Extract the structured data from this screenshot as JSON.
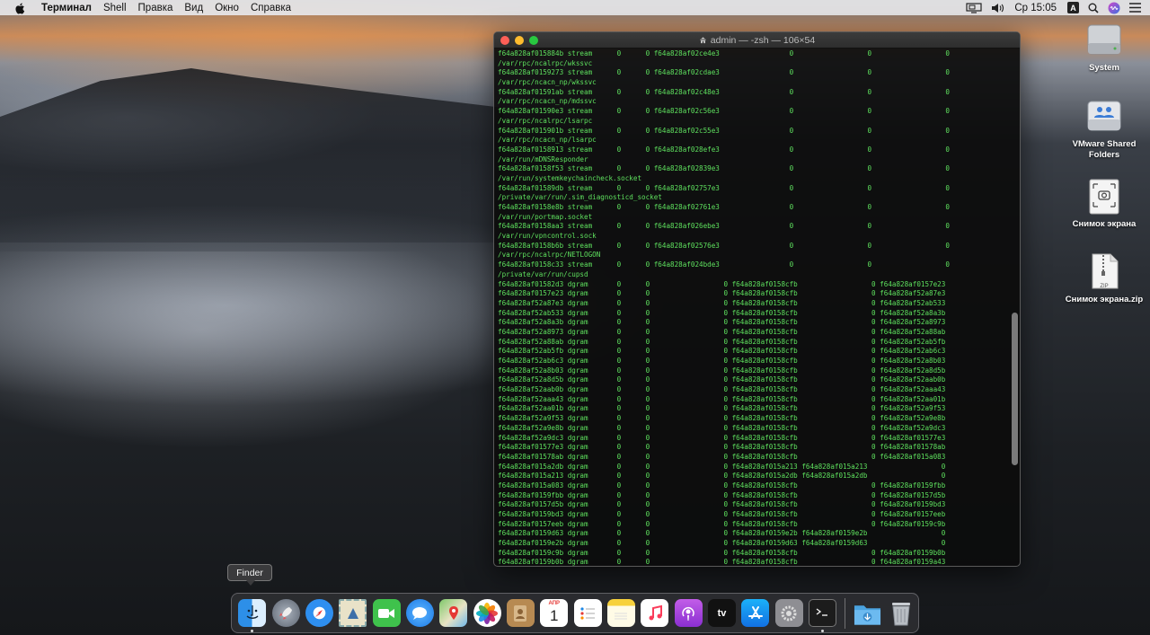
{
  "menubar": {
    "app_name": "Терминал",
    "items": [
      "Shell",
      "Правка",
      "Вид",
      "Окно",
      "Справка"
    ],
    "clock": "Ср 15:05",
    "input_source": "A"
  },
  "terminal": {
    "title": "admin — -zsh — 106×54",
    "lines": [
      "f64a828af015884b stream      0      0 f64a828af02ce4e3                 0                  0                  0",
      "/var/rpc/ncalrpc/wkssvc",
      "f64a828af0159273 stream      0      0 f64a828af02cdae3                 0                  0                  0",
      "/var/rpc/ncacn_np/wkssvc",
      "f64a828af01591ab stream      0      0 f64a828af02c48e3                 0                  0                  0",
      "/var/rpc/ncacn_np/mdssvc",
      "f64a828af01590e3 stream      0      0 f64a828af02c56e3                 0                  0                  0",
      "/var/rpc/ncalrpc/lsarpc",
      "f64a828af015901b stream      0      0 f64a828af02c55e3                 0                  0                  0",
      "/var/rpc/ncacn_np/lsarpc",
      "f64a828af0158913 stream      0      0 f64a828af028efe3                 0                  0                  0",
      "/var/run/mDNSResponder",
      "f64a828af0158f53 stream      0      0 f64a828af02839e3                 0                  0                  0",
      "/var/run/systemkeychaincheck.socket",
      "f64a828af01589db stream      0      0 f64a828af02757e3                 0                  0                  0",
      "/private/var/run/.sim_diagnosticd_socket",
      "f64a828af0158e8b stream      0      0 f64a828af02761e3                 0                  0                  0",
      "/var/run/portmap.socket",
      "f64a828af0158aa3 stream      0      0 f64a828af026ebe3                 0                  0                  0",
      "/var/run/vpncontrol.sock",
      "f64a828af0158b6b stream      0      0 f64a828af02576e3                 0                  0                  0",
      "/var/rpc/ncalrpc/NETLOGON",
      "f64a828af0158c33 stream      0      0 f64a828af024bde3                 0                  0                  0",
      "/private/var/run/cupsd",
      "f64a828af01582d3 dgram       0      0                  0 f64a828af0158cfb                  0 f64a828af0157e23",
      "f64a828af0157e23 dgram       0      0                  0 f64a828af0158cfb                  0 f64a828af52a87e3",
      "f64a828af52a87e3 dgram       0      0                  0 f64a828af0158cfb                  0 f64a828af52ab533",
      "f64a828af52ab533 dgram       0      0                  0 f64a828af0158cfb                  0 f64a828af52a8a3b",
      "f64a828af52a8a3b dgram       0      0                  0 f64a828af0158cfb                  0 f64a828af52a8973",
      "f64a828af52a8973 dgram       0      0                  0 f64a828af0158cfb                  0 f64a828af52a88ab",
      "f64a828af52a88ab dgram       0      0                  0 f64a828af0158cfb                  0 f64a828af52ab5fb",
      "f64a828af52ab5fb dgram       0      0                  0 f64a828af0158cfb                  0 f64a828af52ab6c3",
      "f64a828af52ab6c3 dgram       0      0                  0 f64a828af0158cfb                  0 f64a828af52a8b03",
      "f64a828af52a8b03 dgram       0      0                  0 f64a828af0158cfb                  0 f64a828af52a8d5b",
      "f64a828af52a8d5b dgram       0      0                  0 f64a828af0158cfb                  0 f64a828af52aab0b",
      "f64a828af52aab0b dgram       0      0                  0 f64a828af0158cfb                  0 f64a828af52aaa43",
      "f64a828af52aaa43 dgram       0      0                  0 f64a828af0158cfb                  0 f64a828af52aa01b",
      "f64a828af52aa01b dgram       0      0                  0 f64a828af0158cfb                  0 f64a828af52a9f53",
      "f64a828af52a9f53 dgram       0      0                  0 f64a828af0158cfb                  0 f64a828af52a9e8b",
      "f64a828af52a9e8b dgram       0      0                  0 f64a828af0158cfb                  0 f64a828af52a9dc3",
      "f64a828af52a9dc3 dgram       0      0                  0 f64a828af0158cfb                  0 f64a828af01577e3",
      "f64a828af01577e3 dgram       0      0                  0 f64a828af0158cfb                  0 f64a828af01578ab",
      "f64a828af01578ab dgram       0      0                  0 f64a828af0158cfb                  0 f64a828af015a083",
      "f64a828af015a2db dgram       0      0                  0 f64a828af015a213 f64a828af015a213                  0",
      "f64a828af015a213 dgram       0      0                  0 f64a828af015a2db f64a828af015a2db                  0",
      "f64a828af015a083 dgram       0      0                  0 f64a828af0158cfb                  0 f64a828af0159fbb",
      "f64a828af0159fbb dgram       0      0                  0 f64a828af0158cfb                  0 f64a828af0157d5b",
      "f64a828af0157d5b dgram       0      0                  0 f64a828af0158cfb                  0 f64a828af0159bd3",
      "f64a828af0159bd3 dgram       0      0                  0 f64a828af0158cfb                  0 f64a828af0157eeb",
      "f64a828af0157eeb dgram       0      0                  0 f64a828af0158cfb                  0 f64a828af0159c9b",
      "f64a828af0159d63 dgram       0      0                  0 f64a828af0159e2b f64a828af0159e2b                  0",
      "f64a828af0159e2b dgram       0      0                  0 f64a828af0159d63 f64a828af0159d63                  0",
      "f64a828af0159c9b dgram       0      0                  0 f64a828af0158cfb                  0 f64a828af0159b0b",
      "f64a828af0159b0b dgram       0      0                  0 f64a828af0158cfb                  0 f64a828af0159a43"
    ]
  },
  "desktop_icons": [
    {
      "label": "System",
      "icon": "hard-drive-icon"
    },
    {
      "label": "VMware Shared Folders",
      "icon": "shared-folder-icon"
    },
    {
      "label": "Снимок экрана",
      "icon": "screenshot-file-icon"
    },
    {
      "label": "Снимок экрана.zip",
      "icon": "zip-file-icon",
      "badge": "ZIP"
    }
  ],
  "tooltip": "Finder",
  "dock": {
    "calendar_month": "АПР",
    "calendar_day": "1",
    "tv_label": "tv"
  }
}
